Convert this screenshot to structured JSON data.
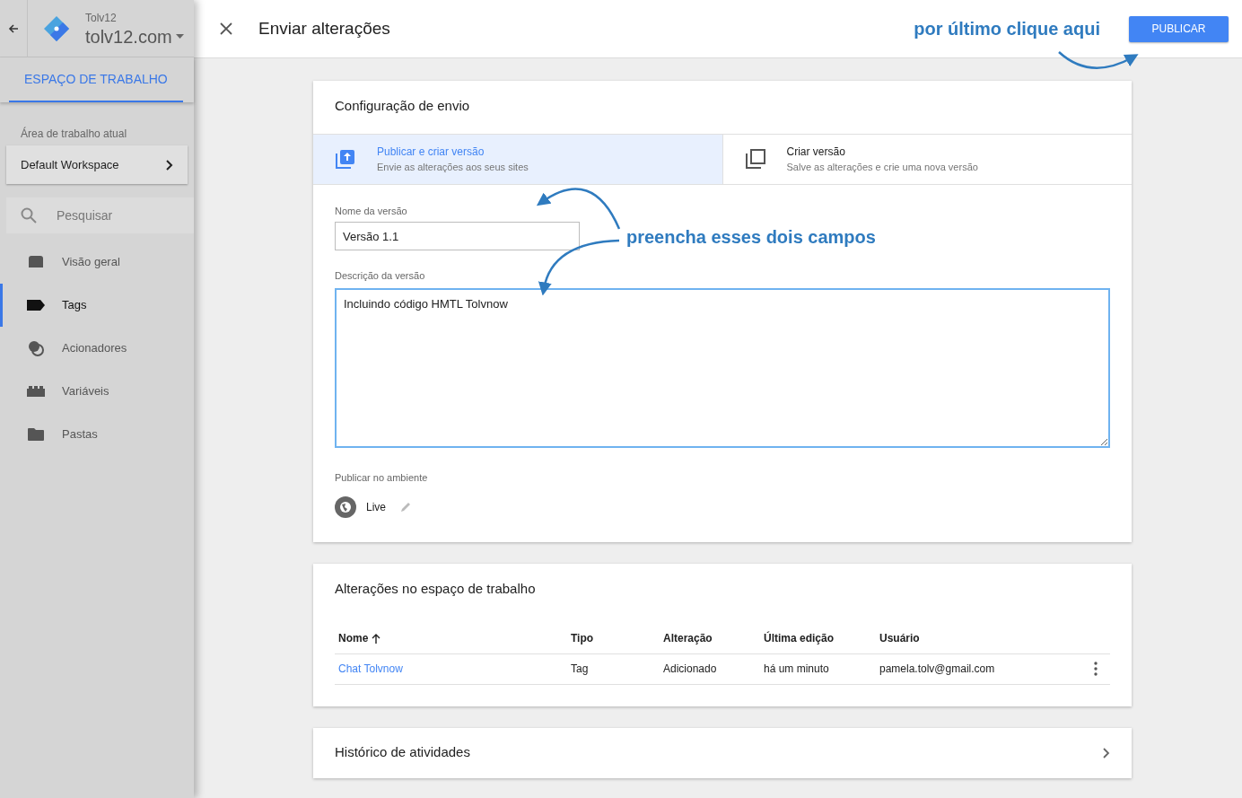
{
  "sidebar": {
    "account": "Tolv12",
    "container": "tolv12.com",
    "tab": {
      "label": "ESPAÇO DE TRABALHO",
      "selected": true
    },
    "workspace_label": "Área de trabalho atual",
    "workspace": "Default Workspace",
    "search": {
      "placeholder": "Pesquisar"
    },
    "items": [
      {
        "kind": "overview",
        "label": "Visão geral",
        "selected": false
      },
      {
        "kind": "tags",
        "label": "Tags",
        "selected": true
      },
      {
        "kind": "triggers",
        "label": "Acionadores",
        "selected": false
      },
      {
        "kind": "variables",
        "label": "Variáveis",
        "selected": false
      },
      {
        "kind": "folders",
        "label": "Pastas",
        "selected": false
      }
    ]
  },
  "header": {
    "title": "Enviar alterações",
    "publish_button": "PUBLICAR"
  },
  "config": {
    "title": "Configuração de envio",
    "options": [
      {
        "kind": "publish",
        "title": "Publicar e criar versão",
        "subtitle": "Envie as alterações aos seus sites",
        "selected": true
      },
      {
        "kind": "version",
        "title": "Criar versão",
        "subtitle": "Salve as alterações e crie uma nova versão",
        "selected": false
      }
    ],
    "version_name": {
      "label": "Nome da versão",
      "value": "Versão 1.1"
    },
    "version_description": {
      "label": "Descrição da versão",
      "value": "Incluindo código HMTL Tolvnow"
    },
    "environment": {
      "label": "Publicar no ambiente",
      "value": "Live"
    }
  },
  "changes": {
    "title": "Alterações no espaço de trabalho",
    "columns": [
      "Nome",
      "Tipo",
      "Alteração",
      "Última edição",
      "Usuário"
    ],
    "rows": [
      {
        "name": "Chat Tolvnow",
        "type": "Tag",
        "change": "Adicionado",
        "edited": "há um minuto",
        "user": "pamela.tolv@gmail.com"
      }
    ]
  },
  "history": {
    "title": "Histórico de atividades"
  },
  "annotations": [
    "por último clique aqui",
    "preencha esses dois campos"
  ]
}
